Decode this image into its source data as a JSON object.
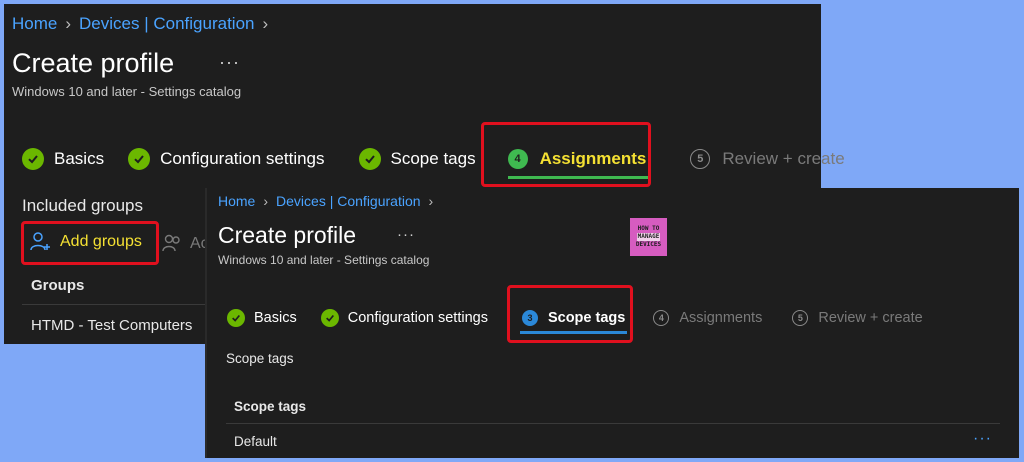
{
  "back": {
    "breadcrumb": {
      "home": "Home",
      "devices": "Devices | Configuration"
    },
    "title": "Create profile",
    "more": "···",
    "subtitle": "Windows 10 and later - Settings catalog",
    "steps": [
      {
        "label": "Basics",
        "state": "done"
      },
      {
        "label": "Configuration settings",
        "state": "done"
      },
      {
        "label": "Scope tags",
        "state": "done"
      },
      {
        "label": "Assignments",
        "state": "current",
        "number": "4"
      },
      {
        "label": "Review + create",
        "state": "upcoming",
        "number": "5"
      }
    ],
    "included_groups": "Included groups",
    "add_groups": "Add groups",
    "add_all": "Ac",
    "groups_header": "Groups",
    "group_row": "HTMD - Test Computers"
  },
  "front": {
    "breadcrumb": {
      "home": "Home",
      "devices": "Devices | Configuration"
    },
    "title": "Create profile",
    "more": "···",
    "subtitle": "Windows 10 and later - Settings catalog",
    "logo": {
      "line1": "HOW TO",
      "line2": "MANAGE",
      "line3": "DEVICES"
    },
    "steps": [
      {
        "label": "Basics",
        "state": "done"
      },
      {
        "label": "Configuration settings",
        "state": "done"
      },
      {
        "label": "Scope tags",
        "state": "current",
        "number": "3"
      },
      {
        "label": "Assignments",
        "state": "upcoming",
        "number": "4"
      },
      {
        "label": "Review + create",
        "state": "upcoming",
        "number": "5"
      }
    ],
    "section_label": "Scope tags",
    "table_header": "Scope tags",
    "row_value": "Default",
    "row_more": "···"
  },
  "colors": {
    "background": "#7fa8f7",
    "panel": "#1e1e1e",
    "link": "#4aa3ff",
    "check_green": "#6bb700",
    "highlight_yellow": "#f5e133",
    "active_underline_green": "#3fb950",
    "active_underline_blue": "#2b88d8",
    "red_box": "#e0101e",
    "logo_purple": "#d65cc0"
  }
}
